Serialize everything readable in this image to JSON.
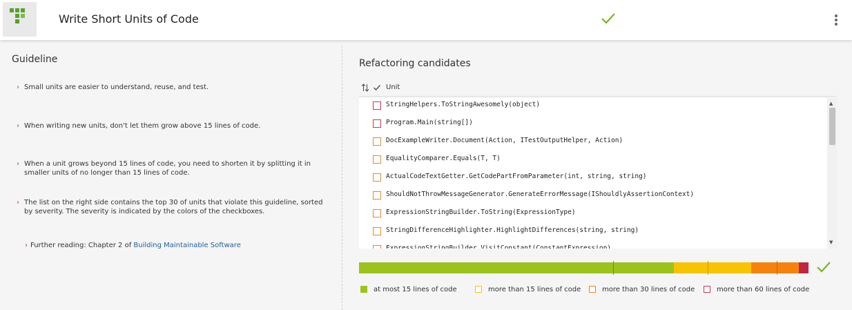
{
  "header": {
    "title": "Write Short Units of Code",
    "icons": {
      "logo": "sig-logo-icon",
      "status": "check-icon",
      "menu": "kebab-menu-icon"
    }
  },
  "guideline": {
    "title": "Guideline",
    "items": [
      "Small units are easier to understand, reuse, and test.",
      "When writing new units, don't let them grow above 15 lines of code.",
      "When a unit grows beyond 15 lines of code, you need to shorten it by splitting it in smaller units of no longer than 15 lines of code.",
      "The list on the right side contains the top 30 of units that violate this guideline, sorted by severity. The severity is indicated by the colors of the checkboxes."
    ],
    "further_reading": {
      "prefix": "Further reading: Chapter 2 of ",
      "link": "Building Maintainable Software"
    }
  },
  "candidates": {
    "title": "Refactoring candidates",
    "column_header": "Unit",
    "units": [
      {
        "name": "StringHelpers.ToStringAwesomely(object)",
        "severity": "more-than-60"
      },
      {
        "name": "Program.Main(string[])",
        "severity": "more-than-60"
      },
      {
        "name": "DocExampleWriter.Document(Action, ITestOutputHelper, Action)",
        "severity": "more-than-30"
      },
      {
        "name": "EqualityComparer.Equals(T, T)",
        "severity": "more-than-30"
      },
      {
        "name": "ActualCodeTextGetter.GetCodePartFromParameter(int, string, string)",
        "severity": "more-than-30"
      },
      {
        "name": "ShouldNotThrowMessageGenerator.GenerateErrorMessage(IShouldlyAssertionContext)",
        "severity": "more-than-30"
      },
      {
        "name": "ExpressionStringBuilder.ToString(ExpressionType)",
        "severity": "more-than-30"
      },
      {
        "name": "StringDifferenceHighlighter.HighlightDifferences(string, string)",
        "severity": "more-than-30"
      },
      {
        "name": "ExpressionStringBuilder.VisitConstant(ConstantExpression)",
        "severity": "more-than-30"
      }
    ]
  },
  "distribution": {
    "segments": [
      {
        "name": "at most 15 lines of code",
        "fraction": 0.7,
        "color": "#9bc31c"
      },
      {
        "name": "more than 15 lines of code",
        "fraction": 0.172,
        "color": "#f8c300"
      },
      {
        "name": "more than 30 lines of code",
        "fraction": 0.106,
        "color": "#f5820d"
      },
      {
        "name": "more than 60 lines of code",
        "fraction": 0.022,
        "color": "#c0263f"
      }
    ],
    "threshold_fractions": [
      0.566,
      0.776,
      0.93
    ]
  },
  "colors": {
    "green": "#9bc31c",
    "yellow": "#f8c300",
    "orange": "#f5820d",
    "red": "#c0263f",
    "link": "#1f5f9b"
  }
}
